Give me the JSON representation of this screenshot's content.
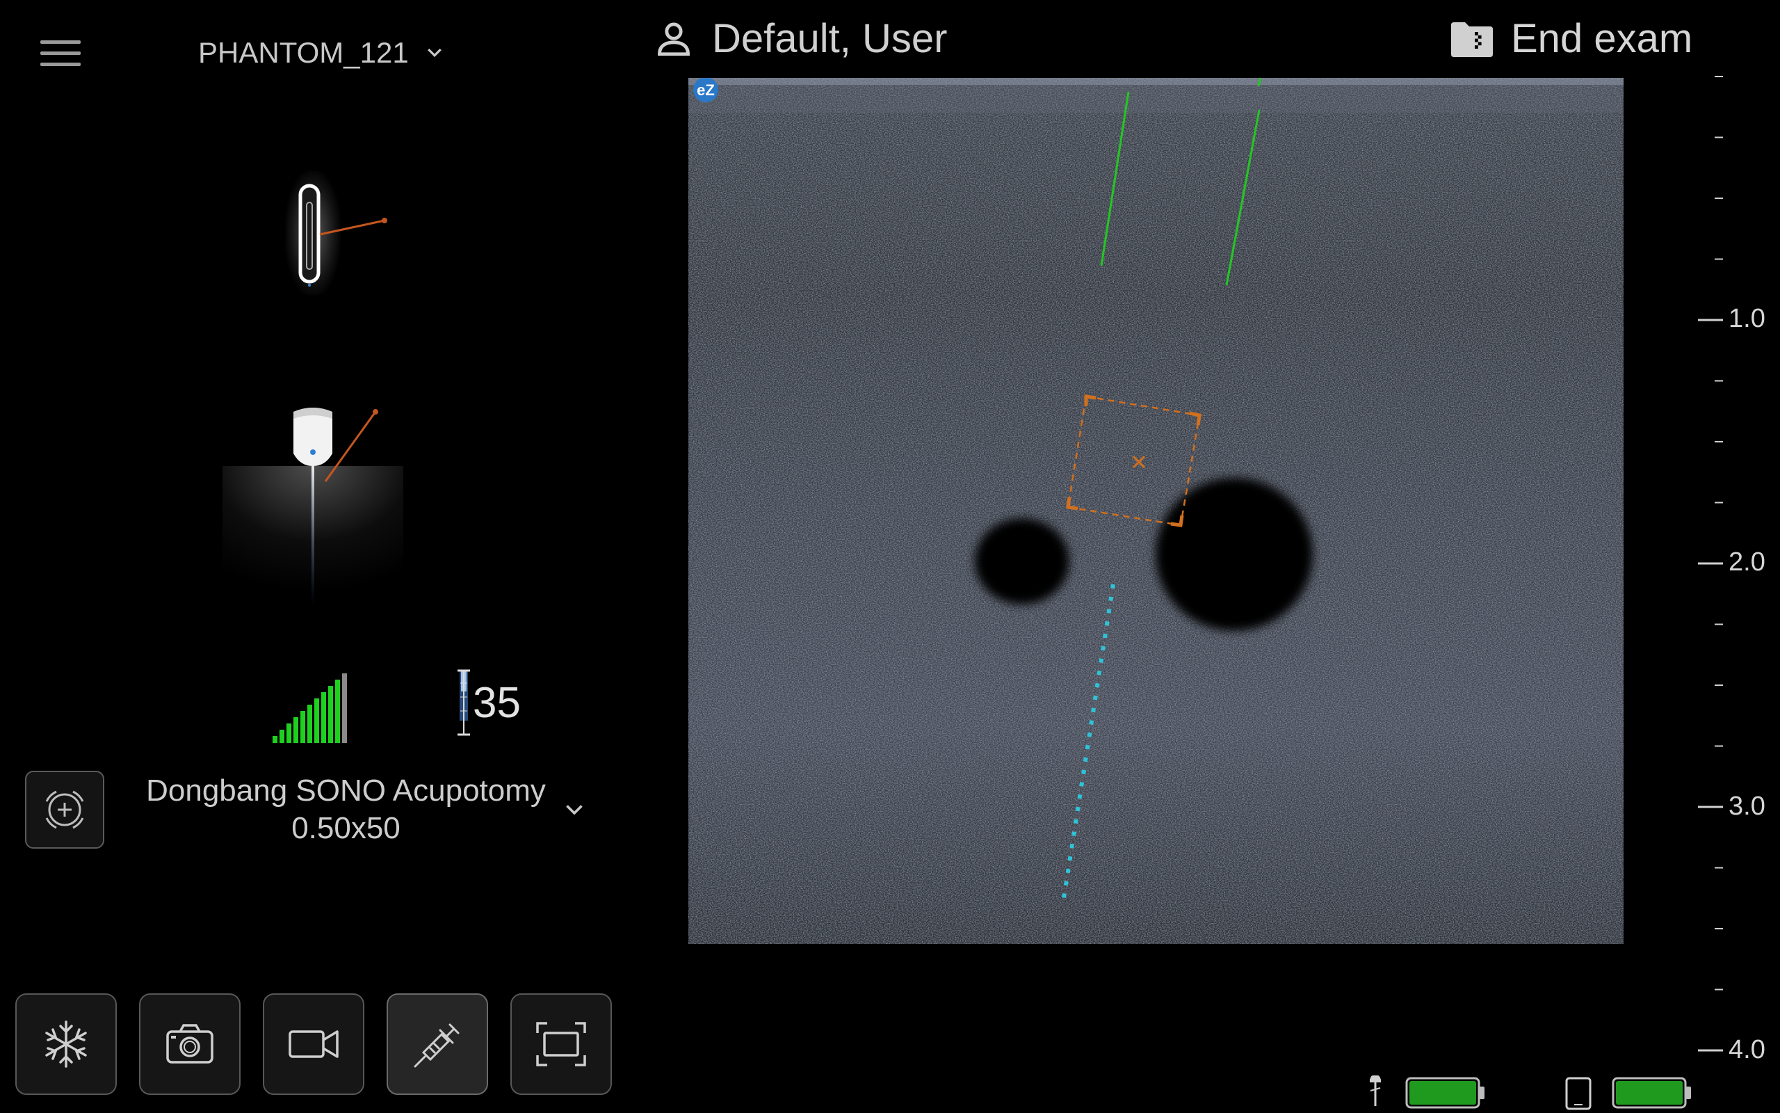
{
  "header": {
    "patient_id": "PHANTOM_121",
    "user_name": "Default, User",
    "end_exam_label": "End exam"
  },
  "icons": {
    "menu": "hamburger-menu-icon",
    "patient_dropdown": "chevron-down-icon",
    "user": "person-icon",
    "end_exam": "folder-icon"
  },
  "left_panel": {
    "signal_level": 1.0,
    "depth_value": "35",
    "needle_name_line1": "Dongbang SONO Acupotomy",
    "needle_name_line2": "0.50x50"
  },
  "toolbar": {
    "tools": [
      {
        "name": "freeze",
        "icon": "snowflake-icon",
        "active": false
      },
      {
        "name": "capture",
        "icon": "camera-icon",
        "active": false
      },
      {
        "name": "record",
        "icon": "video-camera-icon",
        "active": false
      },
      {
        "name": "needle",
        "icon": "syringe-icon",
        "active": true
      },
      {
        "name": "fit",
        "icon": "fullscreen-frame-icon",
        "active": false
      }
    ]
  },
  "image": {
    "logo_text": "eZ",
    "colors": {
      "guide_green": "#22c722",
      "target_orange": "#d2701e",
      "trajectory_cyan": "#2fc3d8"
    }
  },
  "depth_scale": {
    "labels": [
      "1.0",
      "2.0",
      "3.0",
      "4.0"
    ],
    "max_depth": 4.0
  },
  "status": {
    "probe_battery": 1.0,
    "device_battery": 1.0,
    "battery_color": "#1f9a1f"
  }
}
